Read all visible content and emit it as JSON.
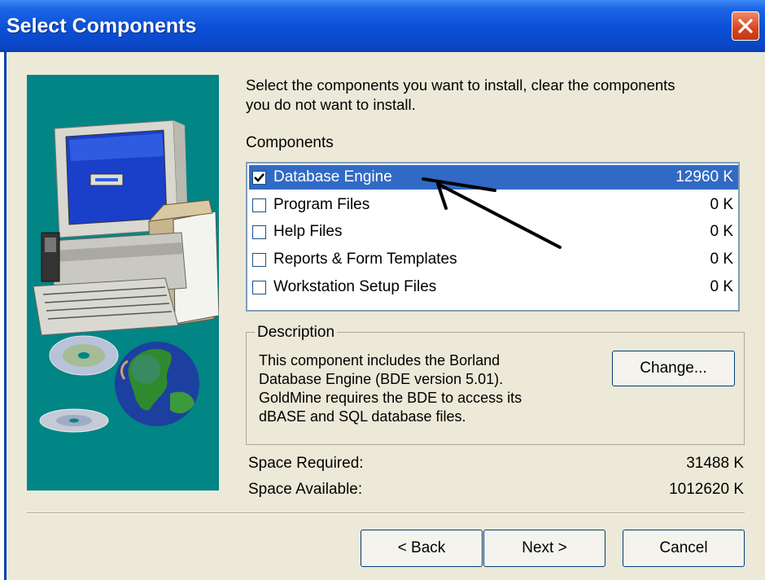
{
  "window": {
    "title": "Select Components",
    "close_icon": "close-icon"
  },
  "instructions": "Select the components you want to install, clear the components\nyou do not want to install.",
  "components_label": "Components",
  "components": [
    {
      "label": "Database Engine",
      "size": "12960 K",
      "checked": true,
      "selected": true
    },
    {
      "label": "Program Files",
      "size": "0 K",
      "checked": false,
      "selected": false
    },
    {
      "label": "Help Files",
      "size": "0 K",
      "checked": false,
      "selected": false
    },
    {
      "label": "Reports & Form Templates",
      "size": "0 K",
      "checked": false,
      "selected": false
    },
    {
      "label": "Workstation Setup Files",
      "size": "0 K",
      "checked": false,
      "selected": false
    }
  ],
  "description": {
    "legend": "Description",
    "text": "This component includes the Borland\nDatabase Engine (BDE version 5.01).\nGoldMine requires the BDE to access its\ndBASE and SQL database files.",
    "change_label": "Change..."
  },
  "space": {
    "required_label": "Space Required:",
    "required_value": "31488 K",
    "available_label": "Space Available:",
    "available_value": "1012620 K"
  },
  "buttons": {
    "back": "< Back",
    "next": "Next >",
    "cancel": "Cancel"
  },
  "colors": {
    "title_bar": "#0a4fd8",
    "selection": "#316ac5",
    "art_background": "#028585",
    "dialog_face": "#ece9d8"
  }
}
